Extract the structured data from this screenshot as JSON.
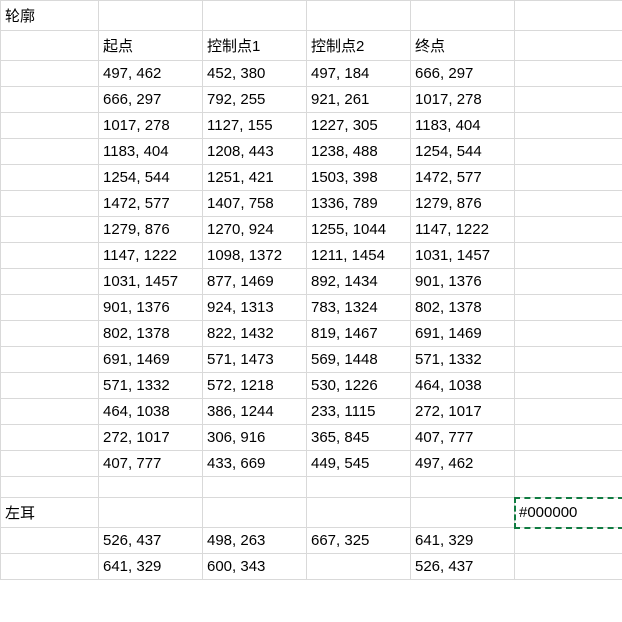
{
  "sections": {
    "outline": {
      "title": "轮廓",
      "headers": [
        "起点",
        "控制点1",
        "控制点2",
        "终点"
      ],
      "rows": [
        [
          "497, 462",
          "452, 380",
          "497, 184",
          "666, 297"
        ],
        [
          "666, 297",
          "792, 255",
          "921, 261",
          "1017, 278"
        ],
        [
          "1017, 278",
          "1127, 155",
          "1227, 305",
          "1183, 404"
        ],
        [
          "1183, 404",
          "1208, 443",
          "1238, 488",
          "1254, 544"
        ],
        [
          "1254, 544",
          "1251, 421",
          "1503, 398",
          "1472, 577"
        ],
        [
          "1472, 577",
          "1407, 758",
          "1336, 789",
          "1279, 876"
        ],
        [
          "1279, 876",
          "1270, 924",
          "1255, 1044",
          "1147, 1222"
        ],
        [
          "1147, 1222",
          "1098, 1372",
          "1211, 1454",
          "1031, 1457"
        ],
        [
          "1031, 1457",
          "877, 1469",
          "892, 1434",
          "901, 1376"
        ],
        [
          "901, 1376",
          "924, 1313",
          "783, 1324",
          "802, 1378"
        ],
        [
          "802, 1378",
          "822, 1432",
          "819, 1467",
          "691, 1469"
        ],
        [
          "691, 1469",
          "571, 1473",
          "569, 1448",
          "571, 1332"
        ],
        [
          "571, 1332",
          "572, 1218",
          "530, 1226",
          "464, 1038"
        ],
        [
          "464, 1038",
          "386, 1244",
          "233, 1115",
          "272, 1017"
        ],
        [
          "272, 1017",
          "306, 916",
          "365, 845",
          "407, 777"
        ],
        [
          "407, 777",
          "433, 669",
          "449, 545",
          "497, 462"
        ]
      ]
    },
    "left_ear": {
      "title": "左耳",
      "color": "#000000",
      "rows": [
        [
          "526, 437",
          "498, 263",
          "667, 325",
          "641, 329"
        ],
        [
          "641, 329",
          "600, 343",
          "",
          "526, 437"
        ]
      ]
    }
  },
  "selection": {
    "col": "F",
    "row": 20
  }
}
